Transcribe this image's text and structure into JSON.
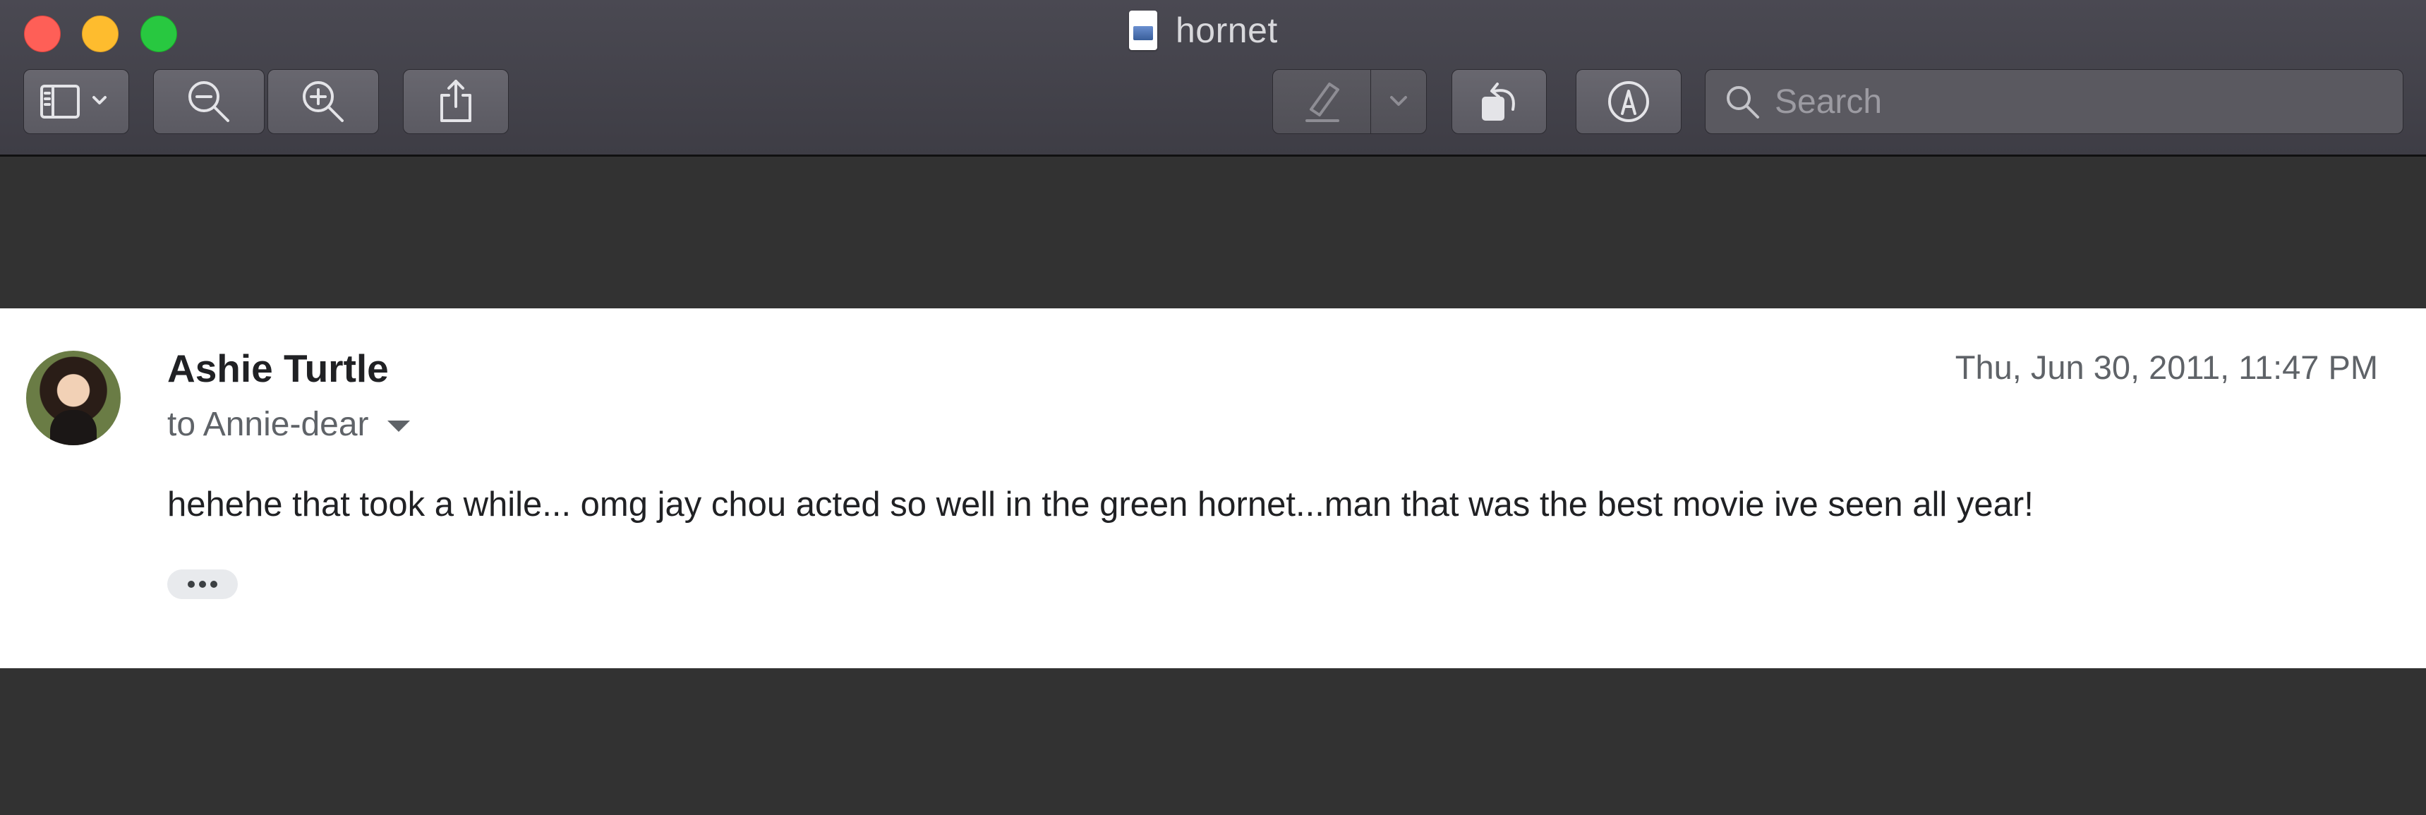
{
  "window": {
    "title": "hornet"
  },
  "toolbar": {
    "sidebar_icon": "sidebar-icon",
    "zoom_out_icon": "zoom-out-icon",
    "zoom_in_icon": "zoom-in-icon",
    "share_icon": "share-icon",
    "highlight_icon": "highlighter-icon",
    "rotate_icon": "rotate-icon",
    "markup_icon": "markup-pen-icon",
    "search": {
      "placeholder": "Search",
      "value": ""
    }
  },
  "email": {
    "sender": "Ashie Turtle",
    "recipient": "to Annie-dear",
    "date": "Thu, Jun 30, 2011, 11:47 PM",
    "body": "hehehe that took a while... omg jay chou acted so well in the green hornet...man that was the best movie ive seen all year!"
  },
  "colors": {
    "close": "#fe5f57",
    "minimize": "#febc2e",
    "maximize": "#28c840",
    "background": "#323232",
    "toolbar": "#45444c"
  }
}
